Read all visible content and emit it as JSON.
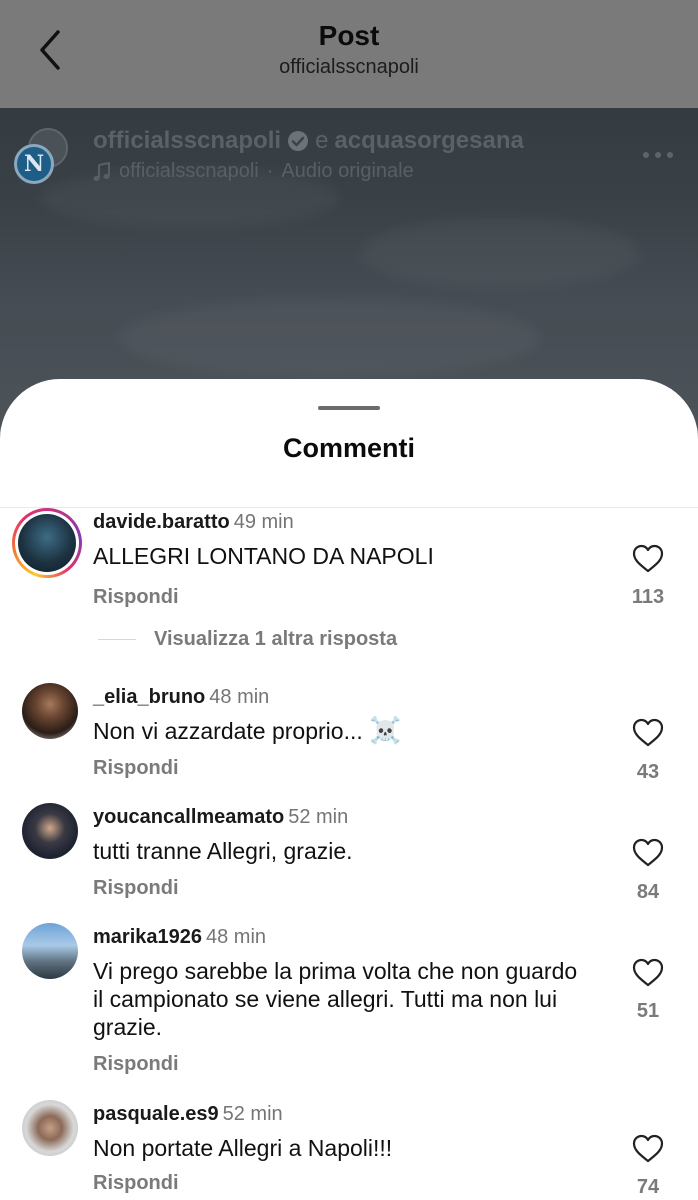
{
  "nav": {
    "title": "Post",
    "subtitle": "officialsscnapoli"
  },
  "post": {
    "author": "officialsscnapoli",
    "conjunction": "e",
    "coauthor": "acquasorgesana",
    "audio_author": "officialsscnapoli",
    "audio_separator": "·",
    "audio_label": "Audio originale",
    "logo_letter": "N"
  },
  "sheet": {
    "title": "Commenti"
  },
  "comments": [
    {
      "username": "davide.baratto",
      "time": "49 min",
      "text": "ALLEGRI LONTANO DA NAPOLI",
      "reply_label": "Rispondi",
      "likes": "113",
      "view_replies": "Visualizza 1 altra risposta",
      "has_story": true
    },
    {
      "username": "_elia_bruno",
      "time": "48 min",
      "text": "Non vi azzardate proprio...",
      "emoji": "☠️",
      "reply_label": "Rispondi",
      "likes": "43"
    },
    {
      "username": "youcancallmeamato",
      "time": "52 min",
      "text": "tutti tranne Allegri, grazie.",
      "reply_label": "Rispondi",
      "likes": "84"
    },
    {
      "username": "marika1926",
      "time": "48 min",
      "text": "Vi prego sarebbe la prima volta che non guardo il campionato se viene allegri. Tutti ma non lui grazie.",
      "reply_label": "Rispondi",
      "likes": "51"
    },
    {
      "username": "pasquale.es9",
      "time": "52 min",
      "text": "Non portate Allegri a Napoli!!!",
      "reply_label": "Rispondi",
      "likes": "74"
    }
  ],
  "colors": {
    "verified": "#6b7278",
    "like_outline": "#222222",
    "secondary_text": "#7a7a7a"
  },
  "icons": [
    "back-arrow-icon",
    "verified-badge-icon",
    "music-note-icon",
    "more-options-icon",
    "heart-icon"
  ]
}
